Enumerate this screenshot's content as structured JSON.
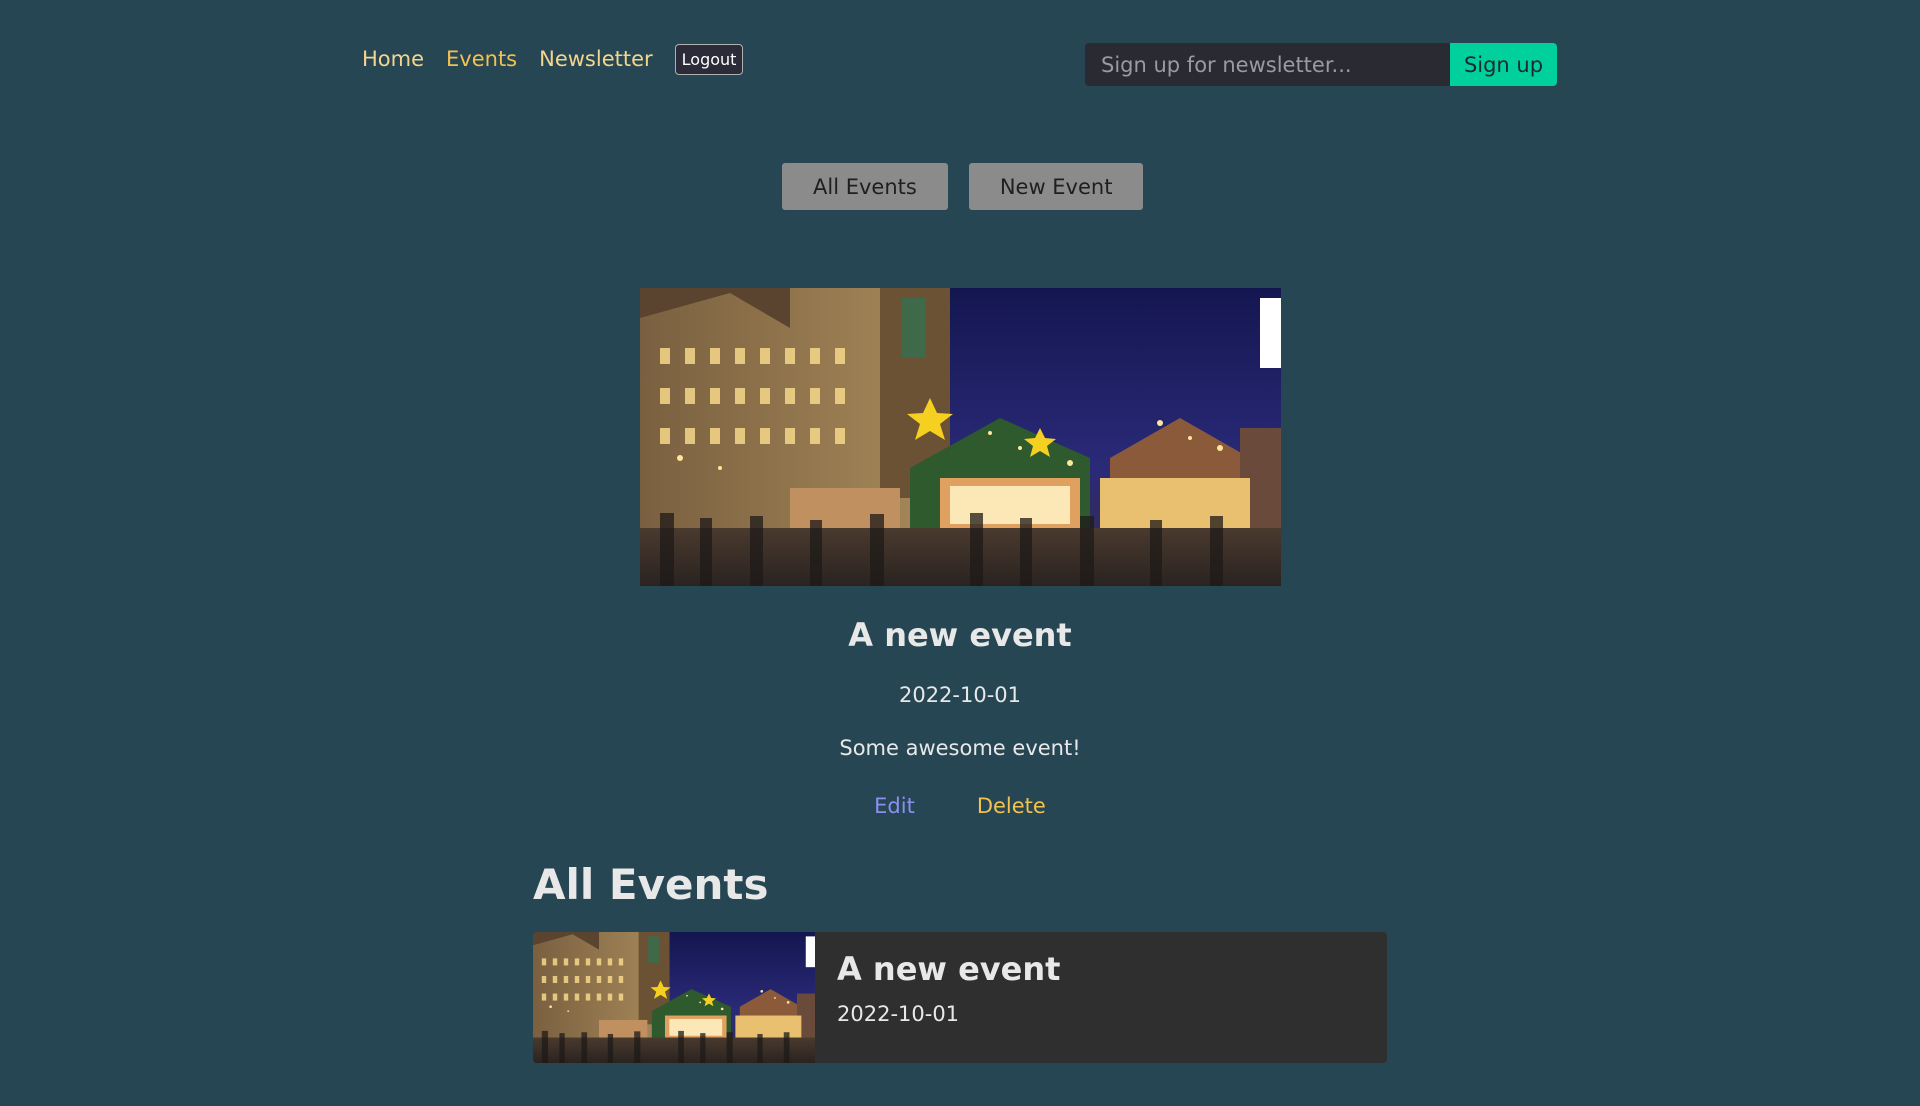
{
  "header": {
    "nav": [
      {
        "label": "Home",
        "active": false
      },
      {
        "label": "Events",
        "active": true
      },
      {
        "label": "Newsletter",
        "active": false
      }
    ],
    "logout_label": "Logout",
    "newsletter": {
      "placeholder": "Sign up for newsletter...",
      "button_label": "Sign up"
    }
  },
  "subnav": {
    "all_events_label": "All Events",
    "new_event_label": "New Event"
  },
  "event_detail": {
    "title": "A new event",
    "date": "2022-10-01",
    "description": "Some awesome event!",
    "edit_label": "Edit",
    "delete_label": "Delete"
  },
  "events_list": {
    "heading": "All Events",
    "items": [
      {
        "title": "A new event",
        "date": "2022-10-01"
      }
    ]
  },
  "colors": {
    "background": "#264653",
    "nav_link": "#f4d58d",
    "nav_active": "#f2c14e",
    "signup_button": "#00d09c",
    "subnav_button": "#8b8b8b",
    "edit_link": "#8c8ef0",
    "delete_link": "#f2c14e",
    "card_background": "#302f2f"
  }
}
